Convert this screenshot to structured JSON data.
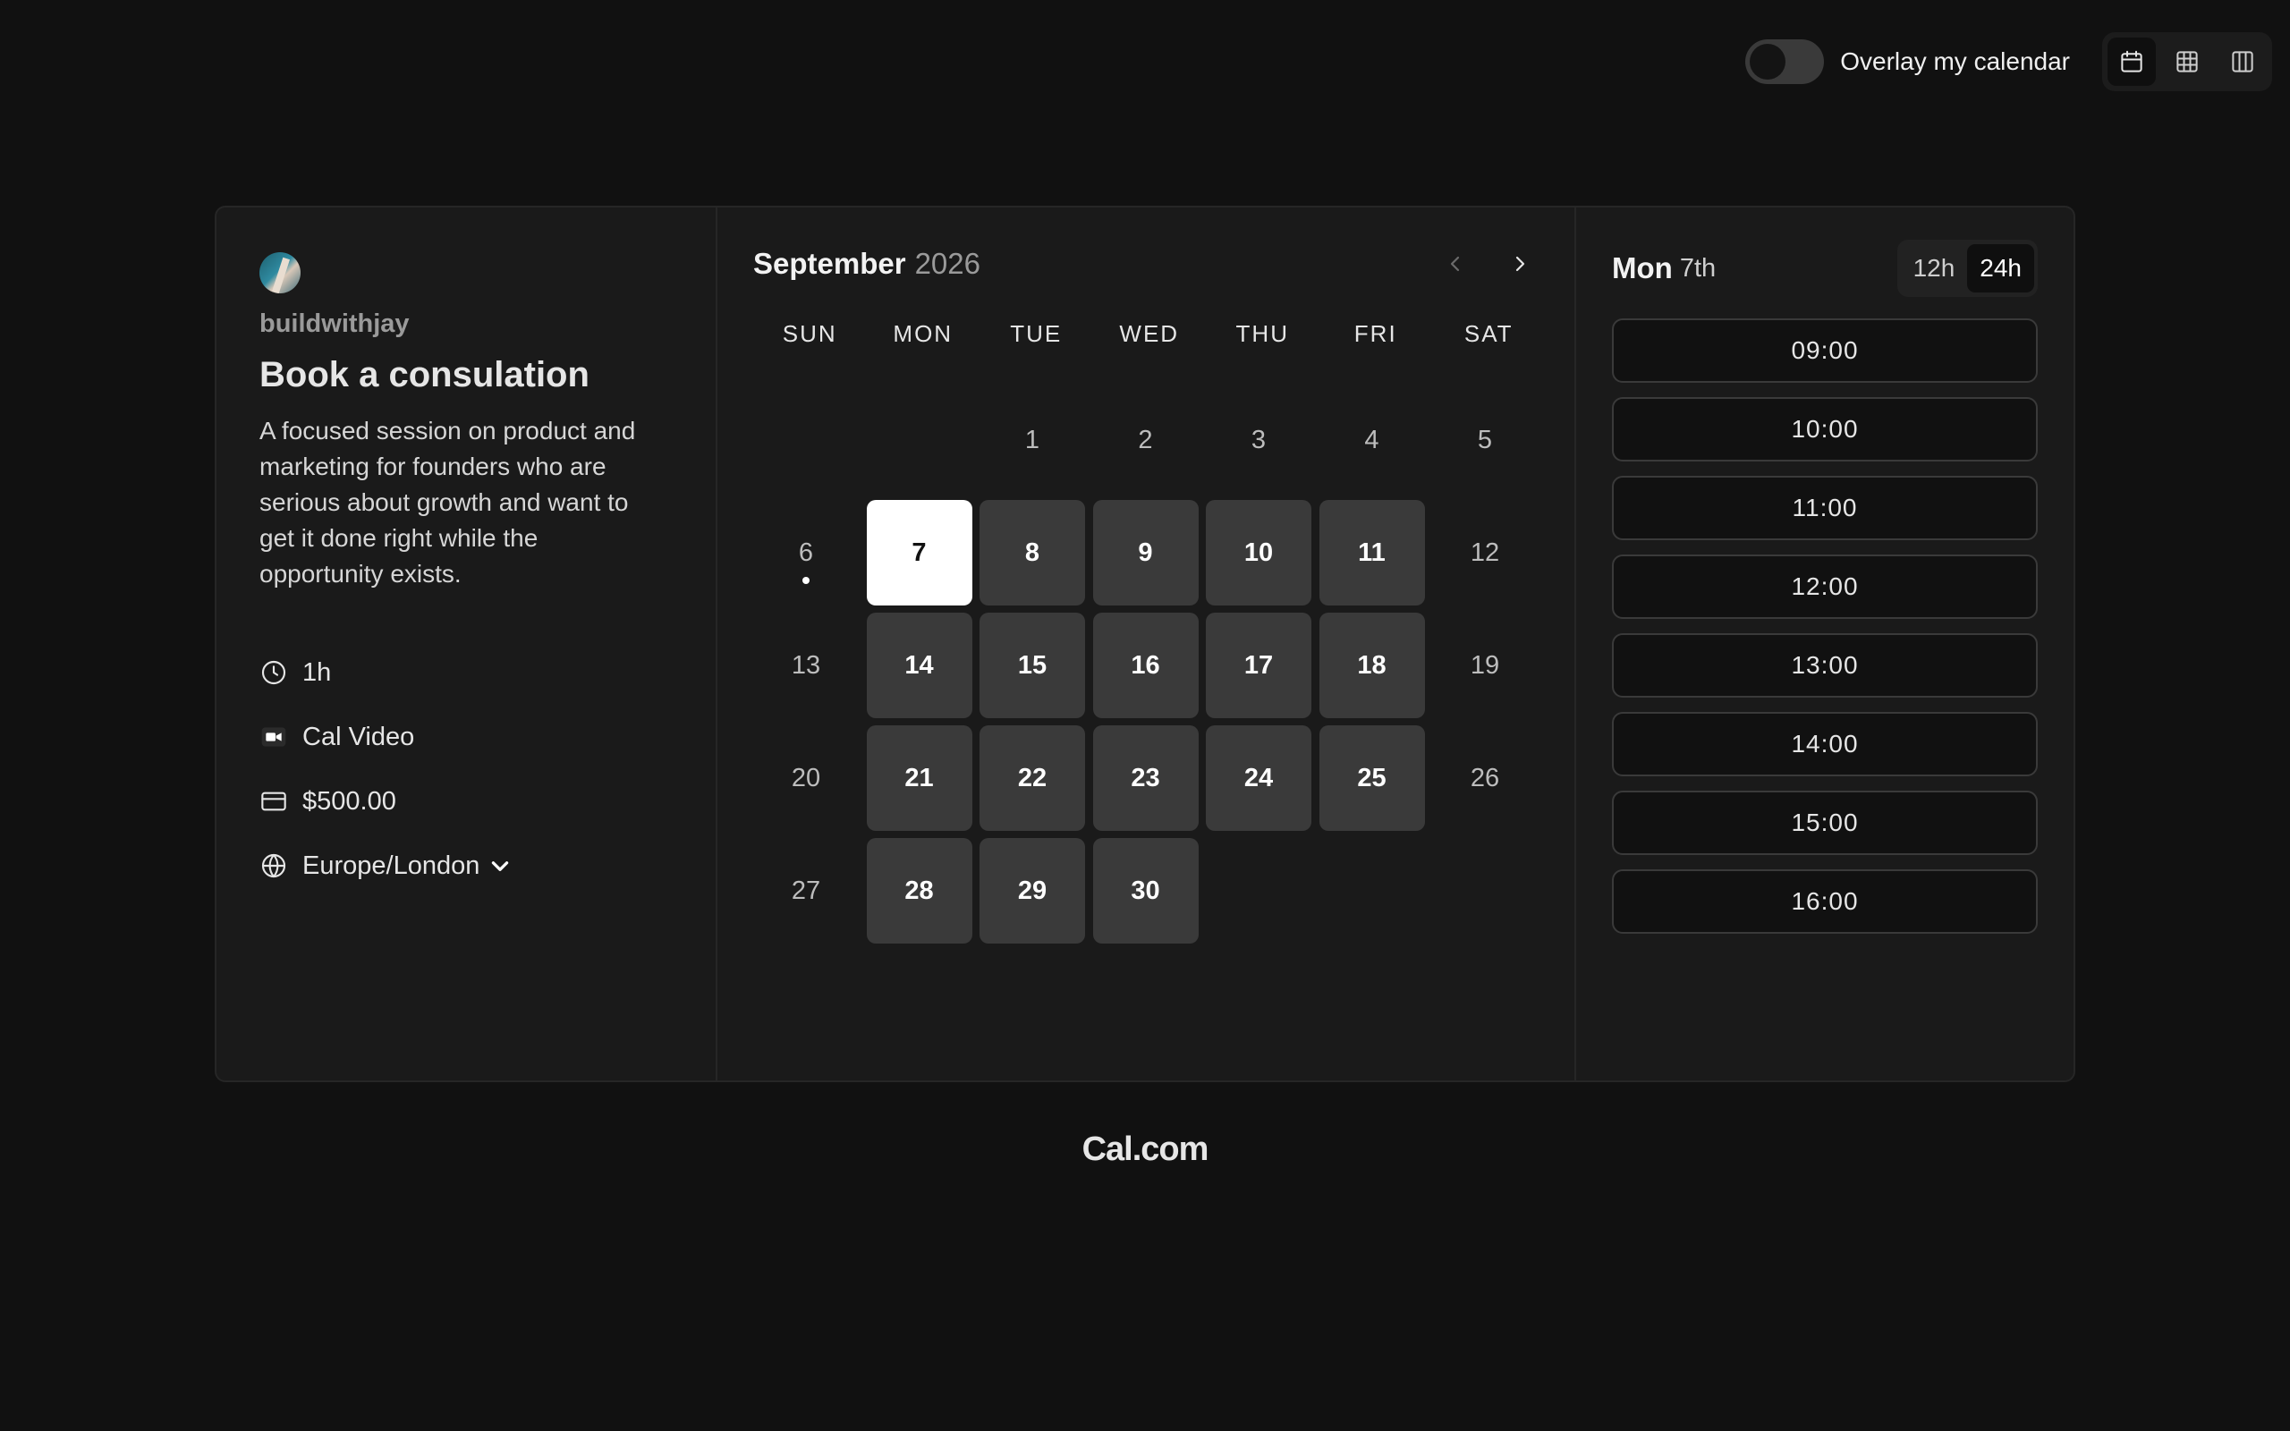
{
  "topbar": {
    "overlay_label": "Overlay my calendar",
    "overlay_enabled": false,
    "views": [
      {
        "name": "month-view",
        "icon": "calendar-icon",
        "active": true
      },
      {
        "name": "weekly-view",
        "icon": "grid-icon",
        "active": false
      },
      {
        "name": "column-view",
        "icon": "columns-icon",
        "active": false
      }
    ]
  },
  "event": {
    "host": "buildwithjay",
    "title": "Book a consulation",
    "description": "A focused session on product and marketing for founders who are serious about growth and want to get it done right while the opportunity exists.",
    "duration": "1h",
    "location": "Cal Video",
    "price": "$500.00",
    "timezone": "Europe/London"
  },
  "calendar": {
    "month": "September",
    "year": "2026",
    "weekdays": [
      "SUN",
      "MON",
      "TUE",
      "WED",
      "THU",
      "FRI",
      "SAT"
    ],
    "days": [
      {
        "label": "",
        "state": "empty"
      },
      {
        "label": "",
        "state": "empty"
      },
      {
        "label": "1",
        "state": "disabled"
      },
      {
        "label": "2",
        "state": "disabled"
      },
      {
        "label": "3",
        "state": "disabled"
      },
      {
        "label": "4",
        "state": "disabled"
      },
      {
        "label": "5",
        "state": "disabled"
      },
      {
        "label": "6",
        "state": "disabled",
        "today": true
      },
      {
        "label": "7",
        "state": "selected"
      },
      {
        "label": "8",
        "state": "available"
      },
      {
        "label": "9",
        "state": "available"
      },
      {
        "label": "10",
        "state": "available"
      },
      {
        "label": "11",
        "state": "available"
      },
      {
        "label": "12",
        "state": "disabled"
      },
      {
        "label": "13",
        "state": "disabled"
      },
      {
        "label": "14",
        "state": "available"
      },
      {
        "label": "15",
        "state": "available"
      },
      {
        "label": "16",
        "state": "available"
      },
      {
        "label": "17",
        "state": "available"
      },
      {
        "label": "18",
        "state": "available"
      },
      {
        "label": "19",
        "state": "disabled"
      },
      {
        "label": "20",
        "state": "disabled"
      },
      {
        "label": "21",
        "state": "available"
      },
      {
        "label": "22",
        "state": "available"
      },
      {
        "label": "23",
        "state": "available"
      },
      {
        "label": "24",
        "state": "available"
      },
      {
        "label": "25",
        "state": "available"
      },
      {
        "label": "26",
        "state": "disabled"
      },
      {
        "label": "27",
        "state": "disabled"
      },
      {
        "label": "28",
        "state": "available"
      },
      {
        "label": "29",
        "state": "available"
      },
      {
        "label": "30",
        "state": "available"
      }
    ]
  },
  "slots": {
    "day": "Mon",
    "date": "7th",
    "formats": [
      {
        "label": "12h",
        "active": false
      },
      {
        "label": "24h",
        "active": true
      }
    ],
    "times": [
      "09:00",
      "10:00",
      "11:00",
      "12:00",
      "13:00",
      "14:00",
      "15:00",
      "16:00"
    ]
  },
  "footer": {
    "brand": "Cal.com"
  }
}
